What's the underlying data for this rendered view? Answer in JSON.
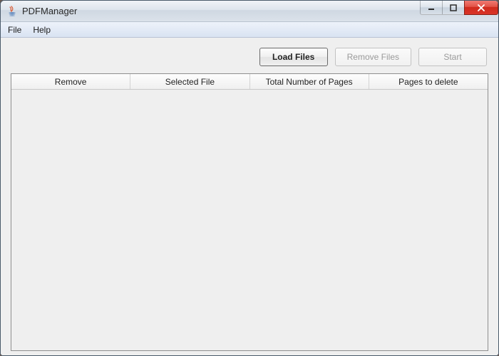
{
  "window": {
    "title": "PDFManager"
  },
  "menubar": {
    "items": [
      "File",
      "Help"
    ]
  },
  "toolbar": {
    "load_files": "Load Files",
    "remove_files": "Remove Files",
    "start": "Start"
  },
  "table": {
    "columns": [
      "Remove",
      "Selected File",
      "Total Number of Pages",
      "Pages to delete"
    ],
    "rows": []
  }
}
